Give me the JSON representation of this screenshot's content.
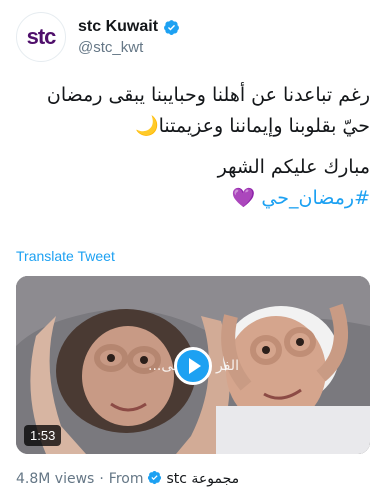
{
  "user": {
    "avatar_text": "stc",
    "display_name": "stc Kuwait",
    "handle": "@stc_kwt",
    "brand_color": "#4f0f6b",
    "verified_icon": "verified-badge-icon"
  },
  "tweet": {
    "line1": "رغم تباعدنا عن أهلنا وحبايبنا يبقى رمضان",
    "line2": "حيّ بقلوبنا وإيماننا وعزيمتنا🌙",
    "line3": "مبارك عليكم الشهر",
    "hashtag": "#رمضان_حي",
    "heart": "💜"
  },
  "translate_label": "Translate Tweet",
  "video": {
    "duration": "1:53",
    "overlay_left": "...بقى",
    "overlay_right": "الفر",
    "play_icon": "play-icon",
    "accent": "#1da1f2"
  },
  "footer": {
    "views": "4.8M views",
    "separator": "·",
    "from_label": "From",
    "source": "stc مجموعة"
  }
}
